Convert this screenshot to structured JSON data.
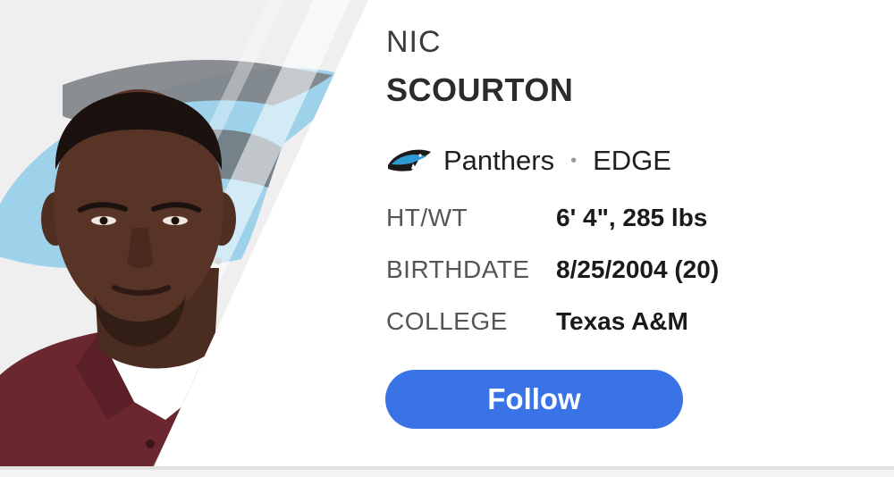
{
  "player": {
    "first_name": "NIC",
    "last_name": "SCOURTON",
    "team": "Panthers",
    "separator": "•",
    "position": "EDGE"
  },
  "stats": [
    {
      "label": "HT/WT",
      "value": "6' 4\", 285 lbs"
    },
    {
      "label": "BIRTHDATE",
      "value": "8/25/2004 (20)"
    },
    {
      "label": "COLLEGE",
      "value": "Texas A&M"
    }
  ],
  "follow": {
    "label": "Follow"
  },
  "icons": {
    "team_logo": "panthers-logo-icon",
    "background_logo": "panthers-watermark-logo"
  },
  "colors": {
    "accent": "#3a73e6",
    "panthers_blue": "#8fcdea",
    "panthers_black": "#1a1a1a",
    "jersey": "#6b2730"
  }
}
